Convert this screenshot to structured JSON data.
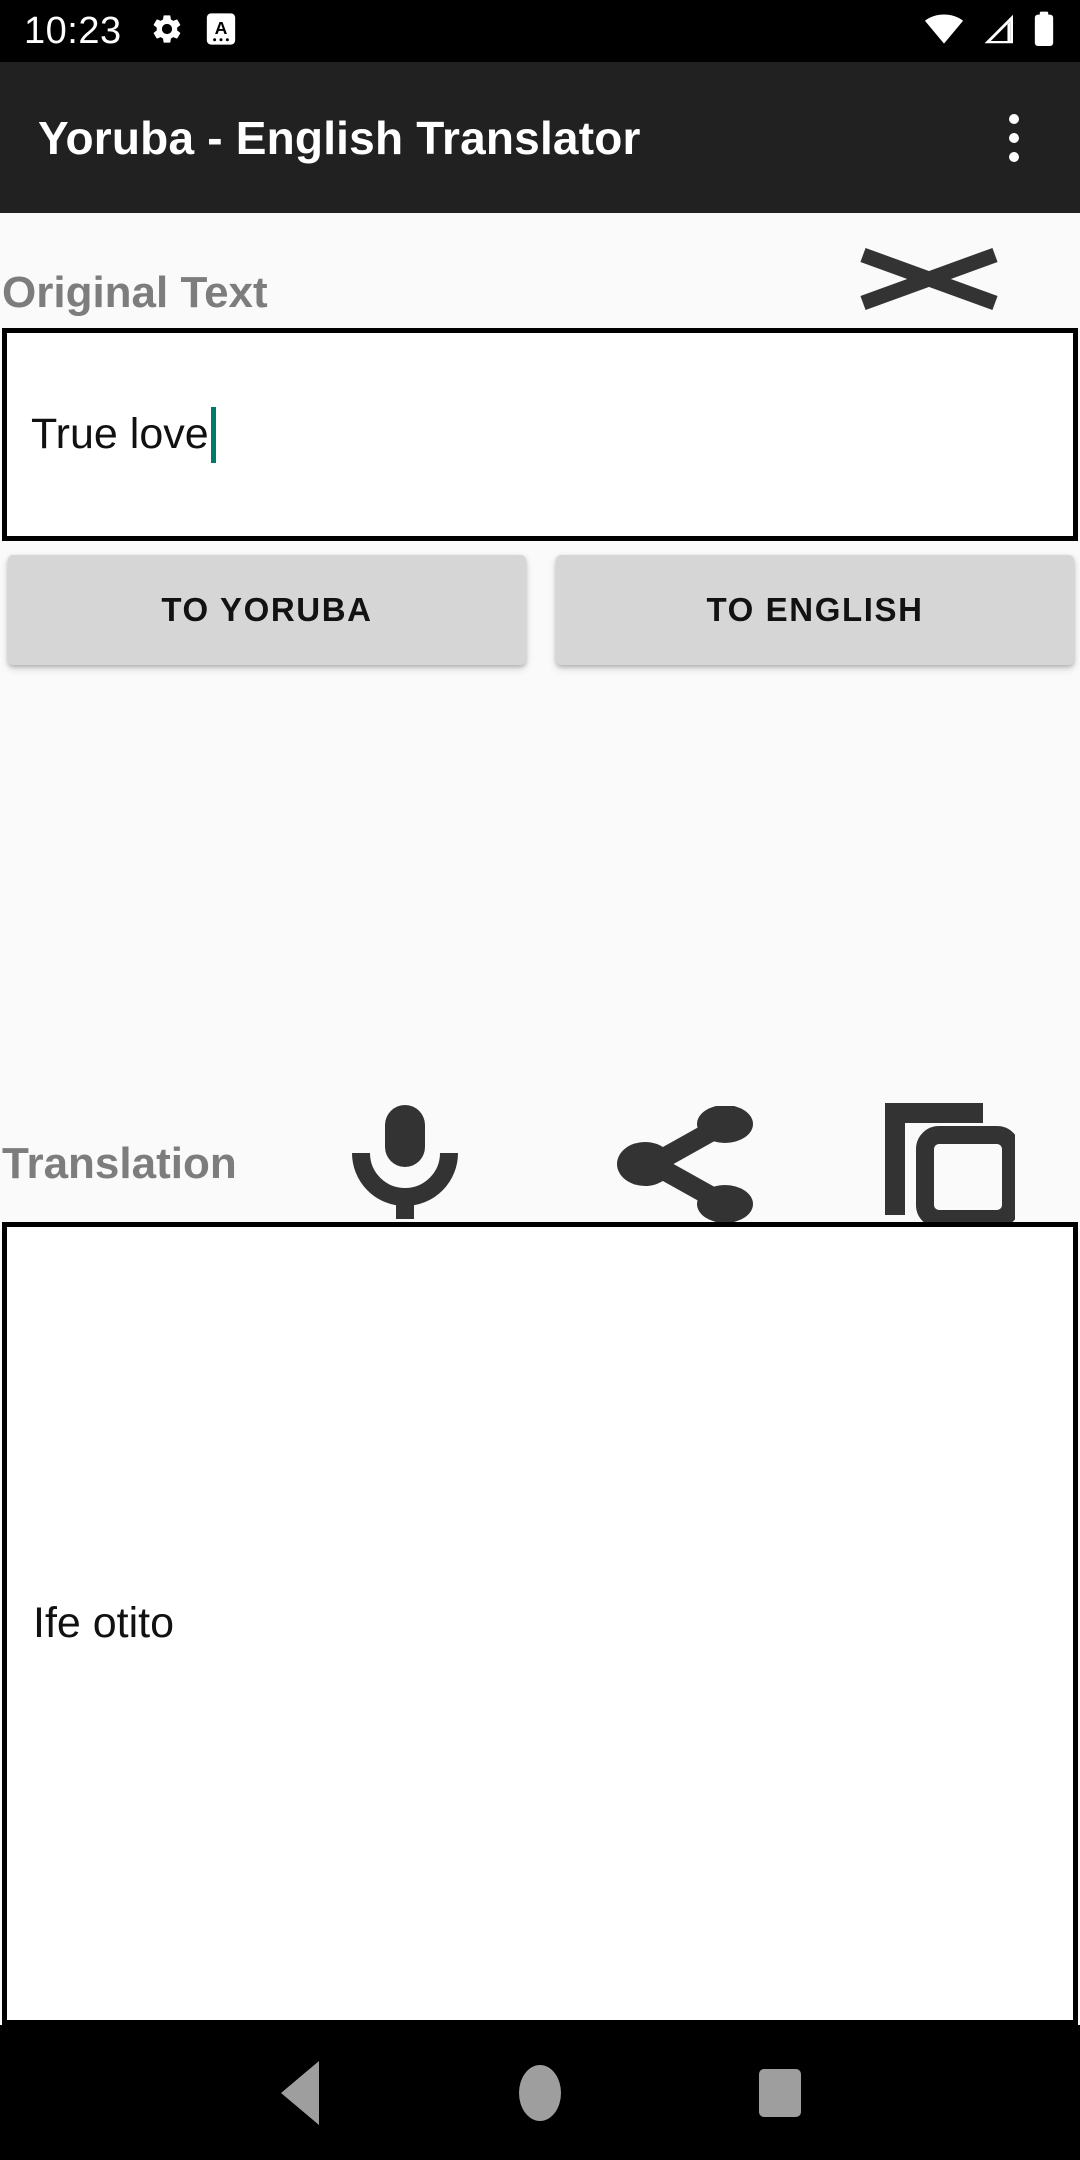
{
  "status_bar": {
    "time": "10:23",
    "left_icons": [
      "gear-icon",
      "a-badge-icon"
    ],
    "right_icons": [
      "wifi-icon",
      "cellular-signal-icon",
      "battery-icon"
    ],
    "background": "#000000",
    "foreground": "#ffffff"
  },
  "app_bar": {
    "title": "Yoruba - English Translator",
    "overflow_menu": "overflow-menu-icon",
    "background": "#212121",
    "title_color": "#ffffff"
  },
  "original_section": {
    "label": "Original Text",
    "clear_icon": "clear-x-icon",
    "input": {
      "value": "True love",
      "placeholder": "",
      "caret_color": "#00796b",
      "border_color": "#000000",
      "background": "#ffffff"
    }
  },
  "actions": {
    "to_yoruba_label": "TO YORUBA",
    "to_english_label": "TO ENGLISH",
    "button_background": "#d6d6d6",
    "button_text_color": "#121212"
  },
  "translation_section": {
    "label": "Translation",
    "icons": [
      {
        "name": "microphone-icon",
        "label": "Speak"
      },
      {
        "name": "share-icon",
        "label": "Share"
      },
      {
        "name": "copy-icon",
        "label": "Copy"
      }
    ],
    "output": {
      "value": "Ife otito",
      "border_color": "#000000",
      "background": "#ffffff"
    }
  },
  "nav_bar": {
    "back": "back-triangle-icon",
    "home": "home-circle-icon",
    "recents": "recents-square-icon",
    "background": "#000000",
    "icon_color": "#9e9e9e"
  },
  "theme": {
    "page_background": "#fafafa",
    "label_color": "#7d7d7d",
    "icon_color": "#333333"
  }
}
